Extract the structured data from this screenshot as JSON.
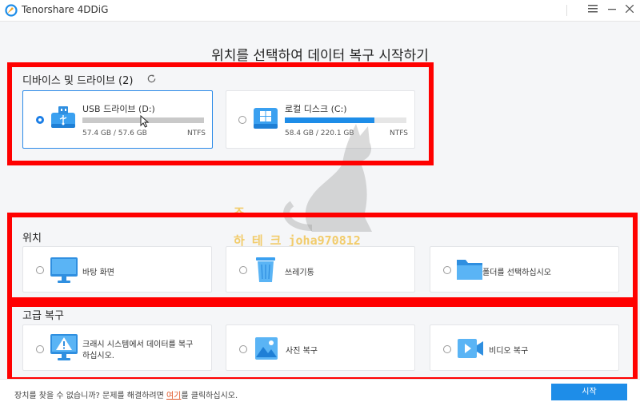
{
  "app": {
    "title": "Tenorshare 4DDiG",
    "logo_colors": [
      "#f5a623",
      "#1e8de8"
    ]
  },
  "window": {
    "menu_icon": "hamburger-icon",
    "minimize_icon": "minimize-icon",
    "close_icon": "close-icon"
  },
  "heading": "위치를 선택하여 데이터 복구 시작하기",
  "drives_section": {
    "label": "디바이스 및 드라이브 (2)",
    "drives": [
      {
        "name": "USB 드라이브 (D:)",
        "size": "57.4 GB / 57.6 GB",
        "fs": "NTFS",
        "usage_fraction": 0.997,
        "selected": true,
        "icon": "usb-drive-icon"
      },
      {
        "name": "로컬 디스크 (C:)",
        "size": "58.4 GB / 220.1 GB",
        "fs": "NTFS",
        "usage_fraction": 0.74,
        "selected": false,
        "icon": "windows-disk-icon"
      }
    ]
  },
  "location_section": {
    "label": "위치",
    "items": [
      {
        "label": "바탕 화면",
        "icon": "desktop-icon"
      },
      {
        "label": "쓰레기통",
        "icon": "recycle-bin-icon"
      },
      {
        "label": "폴더를 선택하십시오",
        "icon": "folder-icon"
      }
    ]
  },
  "advanced_section": {
    "label": "고급 복구",
    "items": [
      {
        "label_line1": "크래시 시스템에서 데이터를 복구",
        "label_line2": "하십시오.",
        "icon": "crash-system-icon"
      },
      {
        "label": "사진 복구",
        "icon": "photo-icon"
      },
      {
        "label": "비디오 복구",
        "icon": "video-icon"
      }
    ]
  },
  "footer": {
    "text_before": "장치를 찾을 수 없습니까? 문제를 해결하려면 ",
    "link": "여기",
    "text_after": "를 클릭하십시오.",
    "start_button": "시작"
  },
  "watermark": {
    "line1": "조",
    "line2": "하 테 크 joha970812"
  },
  "colors": {
    "accent": "#1e8de8",
    "highlight": "#ff0000",
    "link": "#e0582a"
  }
}
